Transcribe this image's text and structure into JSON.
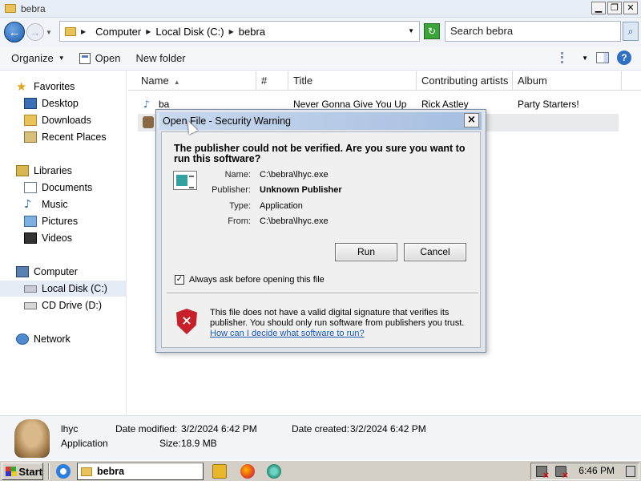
{
  "window": {
    "title": "bebra",
    "minimize": "▁",
    "restore": "❐",
    "close": "✕"
  },
  "nav": {
    "back": "←",
    "forward": "→",
    "breadcrumb": [
      "Computer",
      "Local Disk (C:)",
      "bebra"
    ],
    "search_placeholder": "Search bebra",
    "search_icon": "⌕"
  },
  "toolbar": {
    "organize": "Organize",
    "open": "Open",
    "new_folder": "New folder",
    "help": "?"
  },
  "sidebar": {
    "favorites": "Favorites",
    "desktop": "Desktop",
    "downloads": "Downloads",
    "recent": "Recent Places",
    "libraries": "Libraries",
    "documents": "Documents",
    "music": "Music",
    "pictures": "Pictures",
    "videos": "Videos",
    "computer": "Computer",
    "local_disk": "Local Disk (C:)",
    "cd_drive": "CD Drive (D:)",
    "network": "Network"
  },
  "columns": {
    "name": "Name",
    "number": "#",
    "title": "Title",
    "artists": "Contributing artists",
    "album": "Album"
  },
  "files": [
    {
      "name": "ba",
      "title": "Never Gonna Give You Up",
      "artist": "Rick Astley",
      "album": "Party Starters!"
    }
  ],
  "dialog": {
    "title": "Open File - Security Warning",
    "close": "×",
    "question": "The publisher could not be verified.  Are you sure you want to run this software?",
    "name_label": "Name:",
    "name_value": "C:\\bebra\\lhyc.exe",
    "publisher_label": "Publisher:",
    "publisher_value": "Unknown Publisher",
    "type_label": "Type:",
    "type_value": "Application",
    "from_label": "From:",
    "from_value": "C:\\bebra\\lhyc.exe",
    "run": "Run",
    "cancel": "Cancel",
    "checkbox_label": "Always ask before opening this file",
    "checkbox_checked": "✓",
    "warning_text": "This file does not have a valid digital signature that verifies its publisher.  You should only run software from publishers you trust.",
    "link": "How can I decide what software to run?",
    "shield_mark": "×"
  },
  "details": {
    "filename": "lhyc",
    "filetype": "Application",
    "modified_label": "Date modified:",
    "modified_value": "3/2/2024 6:42 PM",
    "size_label": "Size:",
    "size_value": "18.9 MB",
    "created_label": "Date created:",
    "created_value": "3/2/2024 6:42 PM"
  },
  "taskbar": {
    "start": "Start",
    "task": "bebra",
    "clock": "6:46 PM"
  }
}
